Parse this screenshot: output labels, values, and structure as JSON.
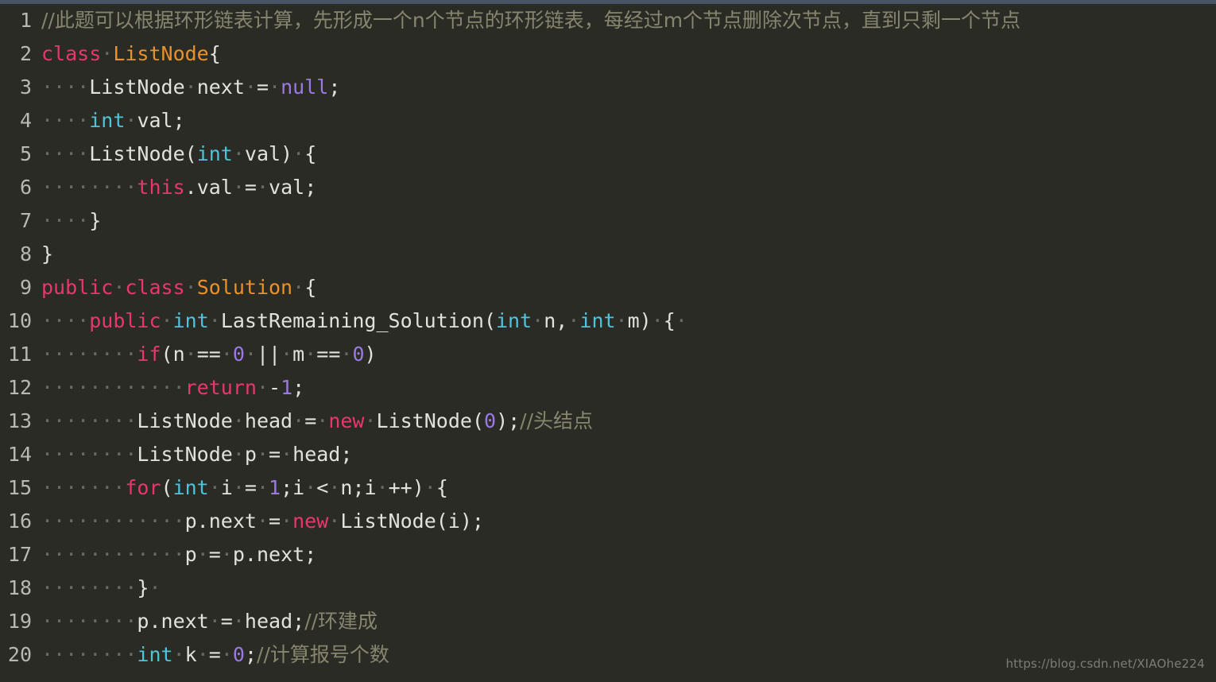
{
  "editor": {
    "background_color": "#2b2b26",
    "topbar_color": "#495366",
    "line_number_color": "#b9b9b2",
    "whitespace_dot": "·",
    "language": "java"
  },
  "palette": {
    "plain": "#e2e2dd",
    "keyword": "#e8386a",
    "type": "#4fc3d9",
    "class_name": "#e8912d",
    "number": "#9a7ae0",
    "comment": "#86866f",
    "whitespace": "#6a6a60"
  },
  "watermark": {
    "text": "https://blog.csdn.net/XIAOhe224"
  },
  "lines": [
    {
      "number": "1",
      "text": "//此题可以根据环形链表计算，先形成一个n个节点的环形链表，每经过m个节点删除次节点，直到只剩一个节点",
      "tokens": [
        {
          "kind": "comment",
          "text": "//此题可以根据环形链表计算，先形成一个n个节点的环形链表，每经过m个节点删除次节点，直到只剩一个节点"
        }
      ]
    },
    {
      "number": "2",
      "text": "class ListNode{",
      "tokens": [
        {
          "kind": "keyword",
          "text": "class"
        },
        {
          "kind": "ws",
          "text": " "
        },
        {
          "kind": "class",
          "text": "ListNode"
        },
        {
          "kind": "plain",
          "text": "{"
        }
      ]
    },
    {
      "number": "3",
      "text": "    ListNode next = null;",
      "tokens": [
        {
          "kind": "ws",
          "text": "    "
        },
        {
          "kind": "plain",
          "text": "ListNode"
        },
        {
          "kind": "ws",
          "text": " "
        },
        {
          "kind": "plain",
          "text": "next"
        },
        {
          "kind": "ws",
          "text": " "
        },
        {
          "kind": "plain",
          "text": "="
        },
        {
          "kind": "ws",
          "text": " "
        },
        {
          "kind": "number",
          "text": "null"
        },
        {
          "kind": "plain",
          "text": ";"
        }
      ]
    },
    {
      "number": "4",
      "text": "    int val;",
      "tokens": [
        {
          "kind": "ws",
          "text": "    "
        },
        {
          "kind": "type",
          "text": "int"
        },
        {
          "kind": "ws",
          "text": " "
        },
        {
          "kind": "plain",
          "text": "val;"
        }
      ]
    },
    {
      "number": "5",
      "text": "    ListNode(int val) {",
      "tokens": [
        {
          "kind": "ws",
          "text": "    "
        },
        {
          "kind": "plain",
          "text": "ListNode("
        },
        {
          "kind": "type",
          "text": "int"
        },
        {
          "kind": "ws",
          "text": " "
        },
        {
          "kind": "plain",
          "text": "val)"
        },
        {
          "kind": "ws",
          "text": " "
        },
        {
          "kind": "plain",
          "text": "{"
        }
      ]
    },
    {
      "number": "6",
      "text": "        this.val = val;",
      "tokens": [
        {
          "kind": "ws",
          "text": "        "
        },
        {
          "kind": "keyword",
          "text": "this"
        },
        {
          "kind": "plain",
          "text": ".val"
        },
        {
          "kind": "ws",
          "text": " "
        },
        {
          "kind": "plain",
          "text": "="
        },
        {
          "kind": "ws",
          "text": " "
        },
        {
          "kind": "plain",
          "text": "val;"
        }
      ]
    },
    {
      "number": "7",
      "text": "    }",
      "tokens": [
        {
          "kind": "ws",
          "text": "    "
        },
        {
          "kind": "plain",
          "text": "}"
        }
      ]
    },
    {
      "number": "8",
      "text": "}",
      "tokens": [
        {
          "kind": "plain",
          "text": "}"
        }
      ]
    },
    {
      "number": "9",
      "text": "public class Solution {",
      "tokens": [
        {
          "kind": "keyword",
          "text": "public"
        },
        {
          "kind": "ws",
          "text": " "
        },
        {
          "kind": "keyword",
          "text": "class"
        },
        {
          "kind": "ws",
          "text": " "
        },
        {
          "kind": "class",
          "text": "Solution"
        },
        {
          "kind": "ws",
          "text": " "
        },
        {
          "kind": "plain",
          "text": "{"
        }
      ]
    },
    {
      "number": "10",
      "text": "    public int LastRemaining_Solution(int n, int m) { ",
      "tokens": [
        {
          "kind": "ws",
          "text": "    "
        },
        {
          "kind": "keyword",
          "text": "public"
        },
        {
          "kind": "ws",
          "text": " "
        },
        {
          "kind": "type",
          "text": "int"
        },
        {
          "kind": "ws",
          "text": " "
        },
        {
          "kind": "plain",
          "text": "LastRemaining_Solution("
        },
        {
          "kind": "type",
          "text": "int"
        },
        {
          "kind": "ws",
          "text": " "
        },
        {
          "kind": "plain",
          "text": "n,"
        },
        {
          "kind": "ws",
          "text": " "
        },
        {
          "kind": "type",
          "text": "int"
        },
        {
          "kind": "ws",
          "text": " "
        },
        {
          "kind": "plain",
          "text": "m)"
        },
        {
          "kind": "ws",
          "text": " "
        },
        {
          "kind": "plain",
          "text": "{"
        },
        {
          "kind": "ws",
          "text": " "
        }
      ]
    },
    {
      "number": "11",
      "text": "        if(n == 0 || m == 0)",
      "tokens": [
        {
          "kind": "ws",
          "text": "        "
        },
        {
          "kind": "keyword",
          "text": "if"
        },
        {
          "kind": "plain",
          "text": "(n"
        },
        {
          "kind": "ws",
          "text": " "
        },
        {
          "kind": "plain",
          "text": "=="
        },
        {
          "kind": "ws",
          "text": " "
        },
        {
          "kind": "number",
          "text": "0"
        },
        {
          "kind": "ws",
          "text": " "
        },
        {
          "kind": "plain",
          "text": "||"
        },
        {
          "kind": "ws",
          "text": " "
        },
        {
          "kind": "plain",
          "text": "m"
        },
        {
          "kind": "ws",
          "text": " "
        },
        {
          "kind": "plain",
          "text": "=="
        },
        {
          "kind": "ws",
          "text": " "
        },
        {
          "kind": "number",
          "text": "0"
        },
        {
          "kind": "plain",
          "text": ")"
        }
      ]
    },
    {
      "number": "12",
      "text": "            return -1;",
      "tokens": [
        {
          "kind": "ws",
          "text": "            "
        },
        {
          "kind": "keyword",
          "text": "return"
        },
        {
          "kind": "ws",
          "text": " "
        },
        {
          "kind": "plain",
          "text": "-"
        },
        {
          "kind": "number",
          "text": "1"
        },
        {
          "kind": "plain",
          "text": ";"
        }
      ]
    },
    {
      "number": "13",
      "text": "        ListNode head = new ListNode(0);//头结点",
      "tokens": [
        {
          "kind": "ws",
          "text": "        "
        },
        {
          "kind": "plain",
          "text": "ListNode"
        },
        {
          "kind": "ws",
          "text": " "
        },
        {
          "kind": "plain",
          "text": "head"
        },
        {
          "kind": "ws",
          "text": " "
        },
        {
          "kind": "plain",
          "text": "="
        },
        {
          "kind": "ws",
          "text": " "
        },
        {
          "kind": "keyword",
          "text": "new"
        },
        {
          "kind": "ws",
          "text": " "
        },
        {
          "kind": "plain",
          "text": "ListNode("
        },
        {
          "kind": "number",
          "text": "0"
        },
        {
          "kind": "plain",
          "text": ");"
        },
        {
          "kind": "comment",
          "text": "//头结点"
        }
      ]
    },
    {
      "number": "14",
      "text": "        ListNode p = head;",
      "tokens": [
        {
          "kind": "ws",
          "text": "        "
        },
        {
          "kind": "plain",
          "text": "ListNode"
        },
        {
          "kind": "ws",
          "text": " "
        },
        {
          "kind": "plain",
          "text": "p"
        },
        {
          "kind": "ws",
          "text": " "
        },
        {
          "kind": "plain",
          "text": "="
        },
        {
          "kind": "ws",
          "text": " "
        },
        {
          "kind": "plain",
          "text": "head;"
        }
      ]
    },
    {
      "number": "15",
      "text": "        for(int i = 1;i < n;i ++) {",
      "tokens": [
        {
          "kind": "ws",
          "text": "       "
        },
        {
          "kind": "keyword",
          "text": "for"
        },
        {
          "kind": "plain",
          "text": "("
        },
        {
          "kind": "type",
          "text": "int"
        },
        {
          "kind": "ws",
          "text": " "
        },
        {
          "kind": "plain",
          "text": "i"
        },
        {
          "kind": "ws",
          "text": " "
        },
        {
          "kind": "plain",
          "text": "="
        },
        {
          "kind": "ws",
          "text": " "
        },
        {
          "kind": "number",
          "text": "1"
        },
        {
          "kind": "plain",
          "text": ";i"
        },
        {
          "kind": "ws",
          "text": " "
        },
        {
          "kind": "plain",
          "text": "<"
        },
        {
          "kind": "ws",
          "text": " "
        },
        {
          "kind": "plain",
          "text": "n;i"
        },
        {
          "kind": "ws",
          "text": " "
        },
        {
          "kind": "plain",
          "text": "++)"
        },
        {
          "kind": "ws",
          "text": " "
        },
        {
          "kind": "plain",
          "text": "{"
        }
      ]
    },
    {
      "number": "16",
      "text": "            p.next = new ListNode(i);",
      "tokens": [
        {
          "kind": "ws",
          "text": "            "
        },
        {
          "kind": "plain",
          "text": "p.next"
        },
        {
          "kind": "ws",
          "text": " "
        },
        {
          "kind": "plain",
          "text": "="
        },
        {
          "kind": "ws",
          "text": " "
        },
        {
          "kind": "keyword",
          "text": "new"
        },
        {
          "kind": "ws",
          "text": " "
        },
        {
          "kind": "plain",
          "text": "ListNode(i);"
        }
      ]
    },
    {
      "number": "17",
      "text": "            p = p.next;",
      "tokens": [
        {
          "kind": "ws",
          "text": "            "
        },
        {
          "kind": "plain",
          "text": "p"
        },
        {
          "kind": "ws",
          "text": " "
        },
        {
          "kind": "plain",
          "text": "="
        },
        {
          "kind": "ws",
          "text": " "
        },
        {
          "kind": "plain",
          "text": "p.next;"
        }
      ]
    },
    {
      "number": "18",
      "text": "        } ",
      "tokens": [
        {
          "kind": "ws",
          "text": "        "
        },
        {
          "kind": "plain",
          "text": "}"
        },
        {
          "kind": "ws",
          "text": " "
        }
      ]
    },
    {
      "number": "19",
      "text": "        p.next = head;//环建成",
      "tokens": [
        {
          "kind": "ws",
          "text": "        "
        },
        {
          "kind": "plain",
          "text": "p.next"
        },
        {
          "kind": "ws",
          "text": " "
        },
        {
          "kind": "plain",
          "text": "="
        },
        {
          "kind": "ws",
          "text": " "
        },
        {
          "kind": "plain",
          "text": "head;"
        },
        {
          "kind": "comment",
          "text": "//环建成"
        }
      ]
    },
    {
      "number": "20",
      "text": "        int k = 0;//计算报号个数",
      "tokens": [
        {
          "kind": "ws",
          "text": "        "
        },
        {
          "kind": "type",
          "text": "int"
        },
        {
          "kind": "ws",
          "text": " "
        },
        {
          "kind": "plain",
          "text": "k"
        },
        {
          "kind": "ws",
          "text": " "
        },
        {
          "kind": "plain",
          "text": "="
        },
        {
          "kind": "ws",
          "text": " "
        },
        {
          "kind": "number",
          "text": "0"
        },
        {
          "kind": "plain",
          "text": ";"
        },
        {
          "kind": "comment",
          "text": "//计算报号个数"
        }
      ]
    }
  ]
}
